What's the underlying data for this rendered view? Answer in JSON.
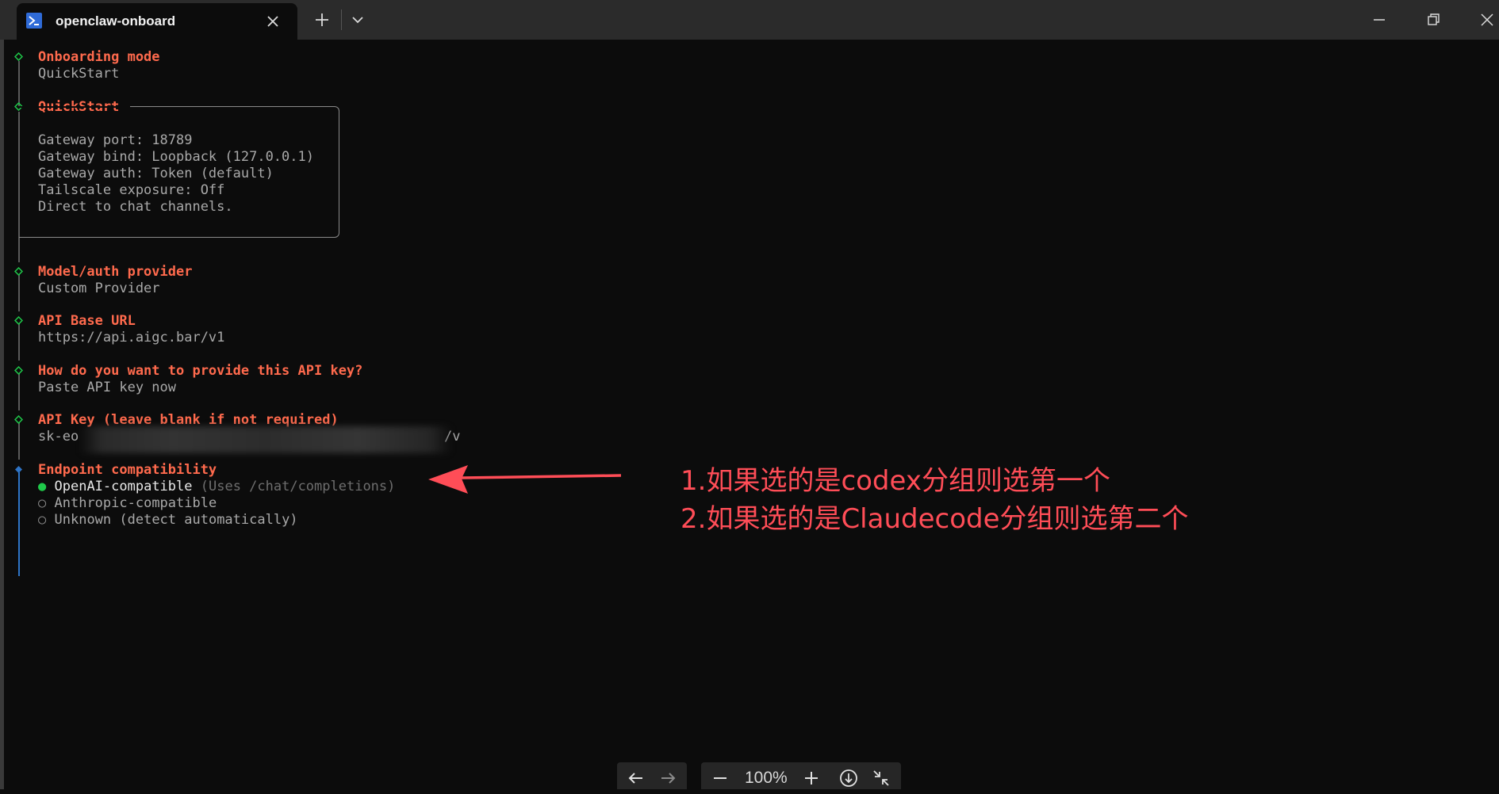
{
  "window": {
    "tab_title": "openclaw-onboard",
    "icons": [
      "powershell-icon",
      "close-icon",
      "plus-icon",
      "chevron-down-icon",
      "minimize-icon",
      "restore-icon",
      "window-close-icon"
    ]
  },
  "terminal": {
    "onboarding_mode": {
      "label": "Onboarding mode",
      "value": "QuickStart"
    },
    "quickstart": {
      "label": "QuickStart",
      "lines": [
        "Gateway port: 18789",
        "Gateway bind: Loopback (127.0.0.1)",
        "Gateway auth: Token (default)",
        "Tailscale exposure: Off",
        "Direct to chat channels."
      ]
    },
    "model_provider": {
      "label": "Model/auth provider",
      "value": "Custom Provider"
    },
    "api_base_url": {
      "label": "API Base URL",
      "value": "https://api.aigc.bar/v1"
    },
    "api_key_method": {
      "label": "How do you want to provide this API key?",
      "value": "Paste API key now"
    },
    "api_key": {
      "label": "API Key (leave blank if not required)",
      "value_prefix": "sk-eo",
      "value_suffix": "/v"
    },
    "endpoint": {
      "label": "Endpoint compatibility",
      "options": [
        {
          "label": "OpenAI-compatible",
          "hint": "(Uses /chat/completions)",
          "selected": true
        },
        {
          "label": "Anthropic-compatible",
          "hint": "",
          "selected": false
        },
        {
          "label": "Unknown (detect automatically)",
          "hint": "",
          "selected": false
        }
      ]
    }
  },
  "annotation": {
    "line1": "1.如果选的是codex分组则选第一个",
    "line2": "2.如果选的是Claudecode分组则选第二个",
    "color": "#ff4d57"
  },
  "zoom_toolbar": {
    "zoom_level": "100%"
  },
  "colors": {
    "heading": "#ff6a4d",
    "value": "#a9a9a9",
    "selected_dot": "#1fc94a",
    "active_diamond": "#2e74c6",
    "done_diamond": "#1fc94a"
  }
}
